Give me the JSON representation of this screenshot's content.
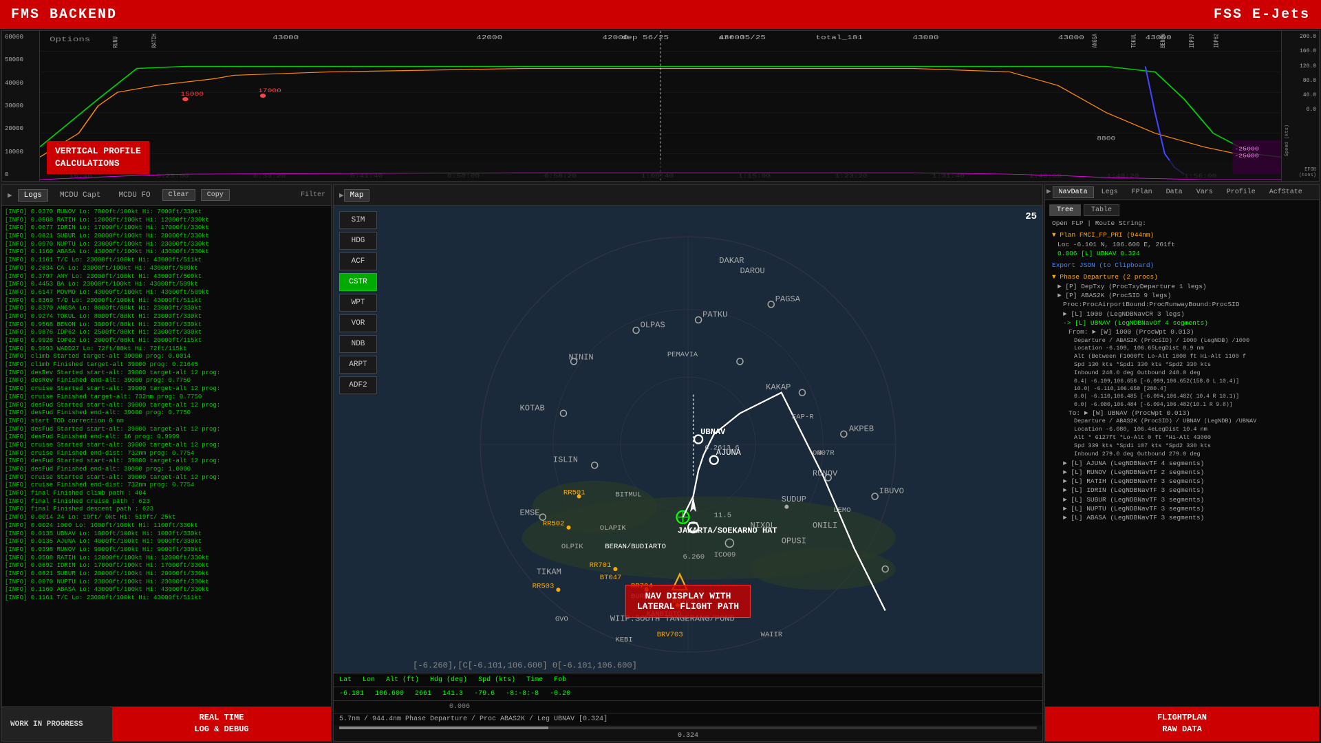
{
  "header": {
    "left_title": "FMS BACKEND",
    "right_title": "FSS E-Jets"
  },
  "vertical_profile": {
    "label_line1": "VERTICAL PROFILE",
    "label_line2": "CALCULATIONS",
    "options_label": "Options",
    "dep_label": "dep 56/25",
    "arr_label": "arr 35/25",
    "total_label": "total_181",
    "y_axis": [
      "60000",
      "50000",
      "40000",
      "30000",
      "20000",
      "10000",
      "0"
    ],
    "y_axis_right": [
      "200.0",
      "160.0",
      "120.0",
      "80.0",
      "40.0",
      "0.0"
    ],
    "speed_label": "Speed (kts)"
  },
  "logs_panel": {
    "header_icon": "▶",
    "title": "Logs",
    "tabs": [
      "MCDU Capt",
      "MCDU FO"
    ],
    "clear_btn": "Clear",
    "copy_btn": "Copy",
    "filter_label": "Filter",
    "footer_line1": "REAL TIME",
    "footer_line2": "LOG & DEBUG",
    "work_in_progress": "WORK IN PROGRESS",
    "log_entries": [
      "[INFO]  0.0370  RUNOV Lo:  7000ft/100kt Hi:  7000ft/330kt",
      "[INFO]  0.0508  RATIH Lo: 12000ft/100kt Hi: 12000ft/330kt",
      "[INFO]  0.0677  IDRIN Lo: 17000ft/100kt Hi: 17000ft/330kt",
      "[INFO]  0.0821  SUBUR Lo: 20000ft/100kt Hi: 20000ft/330kt",
      "[INFO]  0.0970  NUPTU Lo: 23000ft/100kt Hi: 23000ft/330kt",
      "[INFO]  0.1160  ABASA Lo: 43000ft/100kt Hi: 43000ft/330kt",
      "[INFO]  0.1161   T/C Lo: 23000ft/100kt Hi: 43000ft/511kt",
      "[INFO]  0.2634    CA Lo: 23000ft/100kt Hi: 43000ft/509kt",
      "[INFO]  0.3797   ANY Lo: 23000ft/100kt Hi: 43000ft/509kt",
      "[INFO]  0.4453    BA Lo: 23000ft/100kt Hi: 43000ft/509kt",
      "[INFO]  0.6147  MOVMO Lo: 43000ft/100kt Hi: 43000ft/509kt",
      "[INFO]  0.8369   T/D Lo: 23000ft/100kt Hi: 43000ft/511kt",
      "[INFO]  0.8370  ANGSA Lo:  8000ft/88kt Hi: 23000ft/330kt",
      "[INFO]  0.9274  TOKUL Lo:  8000ft/88kt Hi: 23000ft/330kt",
      "[INFO]  0.9568  BENON Lo:  3000ft/88kt Hi: 23000ft/330kt",
      "[INFO]  0.9876  IDP62 Lo:  2500ft/88kt Hi: 23000ft/330kt",
      "[INFO]  0.9928  IOPe2 Lo:  2000ft/88kt Hi: 20000ft/115kt",
      "[INFO]  0.9993  WADD27 Lo:   72ft/88kt Hi:   72ft/115kt",
      "[INFO]  climb  Started target-alt 39000 prog: 0.0014",
      "[INFO]  climb  Finished target-alt 39000 prog: 0.21645",
      "[INFO]  desRev Started start-alt: 39000 target-alt 12 prog:",
      "[INFO]  desRev Finished end-alt: 39000 prog: 0.7750",
      "[INFO]  cruise Started start-alt: 39000 target-alt 12 prog:",
      "[INFO]  cruise Finished target-alt: 732nm prog: 0.7750",
      "[INFO]  cruise Started start-alt: 39000 target-alt 12 prog:",
      "[INFO]  desFud Finished end-alt: 39000 prog: 0.7750",
      "[INFO]  start  TOD correction 0 nm",
      "[INFO]  desFud Started start-alt: 39000 target-alt 12 prog:",
      "[INFO]  desFud Finished end-alt: 16 prog: 0.9999",
      "[INFO]  cruise Started start-alt: 39000 target-alt 12 prog:",
      "[INFO]  cruise Finished end-dist: 732nm prog: 0.7754",
      "[INFO]  desFud Started start-alt: 39000 target-alt 12 prog:",
      "[INFO]  desFud Finished end-alt: 39000 prog: 1.0000",
      "[INFO]  cruise Started start-alt: 39000 target-alt 12 prog:",
      "[INFO]  cruise Finished end-dist: 732nm prog: 0.7754",
      "[INFO]  final  Finished climb path : 404",
      "[INFO]  final  Finished cruise path : 623",
      "[INFO]  final  Finished descent path : 623",
      "[INFO]  0.0014   24 Lo:  19ft/ 0kt Hi:  519ft/ 25kt",
      "[INFO]  0.0024  1000 Lo: 1000ft/100kt Hi: 1100ft/330kt",
      "[INFO]  0.0135  UBNAV Lo: 1000ft/100kt Hi: 1000ft/330kt",
      "[INFO]  0.0135  AJUNA Lo: 4000ft/100kt Hi: 9000ft/330kt",
      "[INFO]  0.0398  RUNOV Lo: 9000ft/100kt Hi: 9000ft/330kt",
      "[INFO]  0.0508  RATIH Lo: 12000ft/100kt Hi: 12000ft/330kt",
      "[INFO]  0.0692  IDRIN Lo: 17000ft/100kt Hi: 17000ft/330kt",
      "[INFO]  0.0821  SUBUR Lo: 20000ft/100kt Hi: 20000ft/330kt",
      "[INFO]  0.0970  NUPTU Lo: 23000ft/100kt Hi: 23000ft/330kt",
      "[INFO]  0.1160  ABASA Lo: 43000ft/100kt Hi: 43000ft/330kt",
      "[INFO]  0.1161   T/C Lo: 23000ft/100kt Hi: 43000ft/511kt"
    ]
  },
  "map_panel": {
    "header_icon": "▶",
    "title": "Map",
    "sim_btn": "SIM",
    "hdg_btn": "HDG",
    "acf_btn": "ACF",
    "cstr_btn": "CSTR",
    "wpt_btn": "WPT",
    "vor_btn": "VOR",
    "ndb_btn": "NDB",
    "arpt_btn": "ARPT",
    "adf2_btn": "ADF2",
    "range": "25",
    "overlay_line1": "NAV DISPLAY WITH",
    "overlay_line2": "LATERAL FLIGHT PATH",
    "info_headers": [
      "Lat",
      "Lon",
      "Alt (ft)",
      "Hdg (deg)",
      "Spd (kts)",
      "Time",
      "Fob"
    ],
    "info_values": [
      "-6.101",
      "106.600",
      "2661",
      "141.3",
      "-79.6",
      "-8:-8:-8",
      "-0.20"
    ],
    "coords_text": "5.7nm / 944.4nm Phase Departure / Proc ABAS2K / Leg UBNAV [0.324]",
    "progress_value": "0.324",
    "coords_detail": "[-6.260],[C[-6.101,106.600] 0[-6.101,106.600]",
    "waypoint_value": "0.006",
    "place_label": "WIIP:SOUTH TANGERANG/POND"
  },
  "navdata_panel": {
    "header_icon": "▶",
    "tabs": [
      "NavData",
      "Legs",
      "FPlan",
      "Data",
      "Vars",
      "Profile",
      "AcfState"
    ],
    "tree_btn": "Tree",
    "table_btn": "Table",
    "open_flp": "Open FLP | Route String:",
    "plan_title": "▼ Plan FMCI_FP_PRI (944nm)",
    "loc_text": "Loc -6.101 N, 106.600 E, 261ft",
    "ubnav_text": "0.006 [L] UBNAV 0.324",
    "export_btn": "Export JSON (to Clipboard)",
    "phase_departure": "▼ Phase Departure (2 procs)",
    "dep_ixu": "  ► [P] DepTxy (ProcTxyDeparture 1 legs)",
    "dep_abas": "  ► [P] ABAS2K (ProcSID 9 legs)",
    "proc_text": "Proc:ProcAirportBound:ProcRunwayBound:ProcSID",
    "leg1000": "    ► [L] 1000 (LegNDBNavCR 3 legs)",
    "leg_ubnav": "    -> [L] UBNAV (LegNDBNavOf 4 segments)",
    "from_text": "    From:  ► [W] 1000 (ProcWpt 0.013)",
    "dep_abas2k": "        Departure / ABAS2K (ProcSID) / 1000 (LegNDB) /1000",
    "loc_dep": "        Location    -6.109, 106.65LegDist    0.9 nm",
    "alt_dep": "        Alt (Between F1000ft    Lo-Alt 1000 ft Hi-Alt 1100 f",
    "spd_dep": "        Spd         130 kts      *Spd1 330 kts *Spd2 330 kts",
    "inbound_dep": "        Inbound     248.0 deg   Outbound    248.0 deg",
    "seg_text": "        0.4| -6.109,106.656 [-6.099,106.652(158.0 L 10.4)]",
    "seg2": "        10.0| -6.110,106.650 [280.4]",
    "seg3": "        0.0| -6.110,106.485 [-6.094,106.482( 10.4 R 10.1)]",
    "seg4": "        0.0| -6.080,106.484 [-6.094,106.482(10.1 R  9.8)]",
    "to_text": "    To:   ► [W] UBNAV (ProcWpt 0.013)",
    "to_dep": "        Departure / ABAS2K (ProcSID) / UBNAV (LegNDB) /UBNAV",
    "to_loc": "        Location    -6.080, 106.4eLegDist    10.4 nm",
    "to_alt": "        Alt         * 6127ft    *Lo-Alt 0 ft *Hi-Alt 43000",
    "to_spd": "        Spd         339 kts      *Spd1 107 kts *Spd2 330 kts",
    "to_inbound": "        Inbound     279.0 deg   Outbound    279.0 deg",
    "ajuna": "  ► [L] AJUNA (LegNDBNavTF 4 segments)",
    "runov": "  ► [L] RUNOV (LegNDBNavTF 2 segments)",
    "ratih": "  ► [L] RATIH (LegNDBNavTF 3 segments)",
    "idrin": "  ► [L] IDRIN (LegNDBNavTF 3 segments)",
    "subur": "  ► [L] SUBUR (LegNDBNavTF 3 segments)",
    "nuptu": "  ► [L] NUPTU (LegNDBNavTF 3 segments)",
    "abasa": "  ► [L] ABASA (LegNDBNavTF 3 segments)",
    "footer_line1": "FLIGHTPLAN",
    "footer_line2": "RAW DATA",
    "profile_tab": "Profile"
  }
}
